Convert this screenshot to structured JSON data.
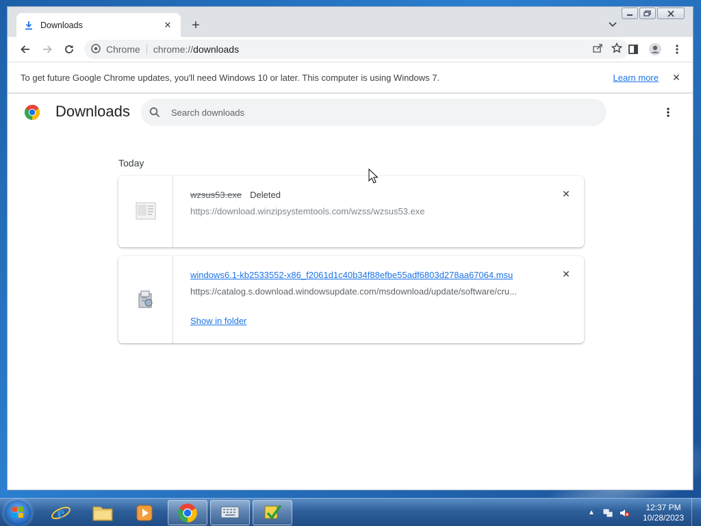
{
  "tab": {
    "title": "Downloads"
  },
  "omnibox": {
    "site_label": "Chrome",
    "url_scheme": "chrome://",
    "url_host": "downloads"
  },
  "infobar": {
    "message": "To get future Google Chrome updates, you'll need Windows 10 or later. This computer is using Windows 7.",
    "link": "Learn more"
  },
  "page": {
    "title": "Downloads",
    "search_placeholder": "Search downloads",
    "date_group": "Today"
  },
  "downloads": [
    {
      "filename": "wzsus53.exe",
      "status": "Deleted",
      "url": "https://download.winzipsystemtools.com/wzss/wzsus53.exe"
    },
    {
      "filename": "windows6.1-kb2533552-x86_f2061d1c40b34f88efbe55adf6803d278aa67064.msu",
      "url": "https://catalog.s.download.windowsupdate.com/msdownload/update/software/cru...",
      "action": "Show in folder"
    }
  ],
  "taskbar": {
    "clock_time": "12:37 PM",
    "clock_date": "10/28/2023",
    "apps": [
      "internet-explorer",
      "windows-explorer",
      "media-player",
      "chrome",
      "keyboard-app",
      "checkmark-app"
    ]
  },
  "colors": {
    "accent": "#1a73e8",
    "taskbar": "#2e5f9a"
  }
}
